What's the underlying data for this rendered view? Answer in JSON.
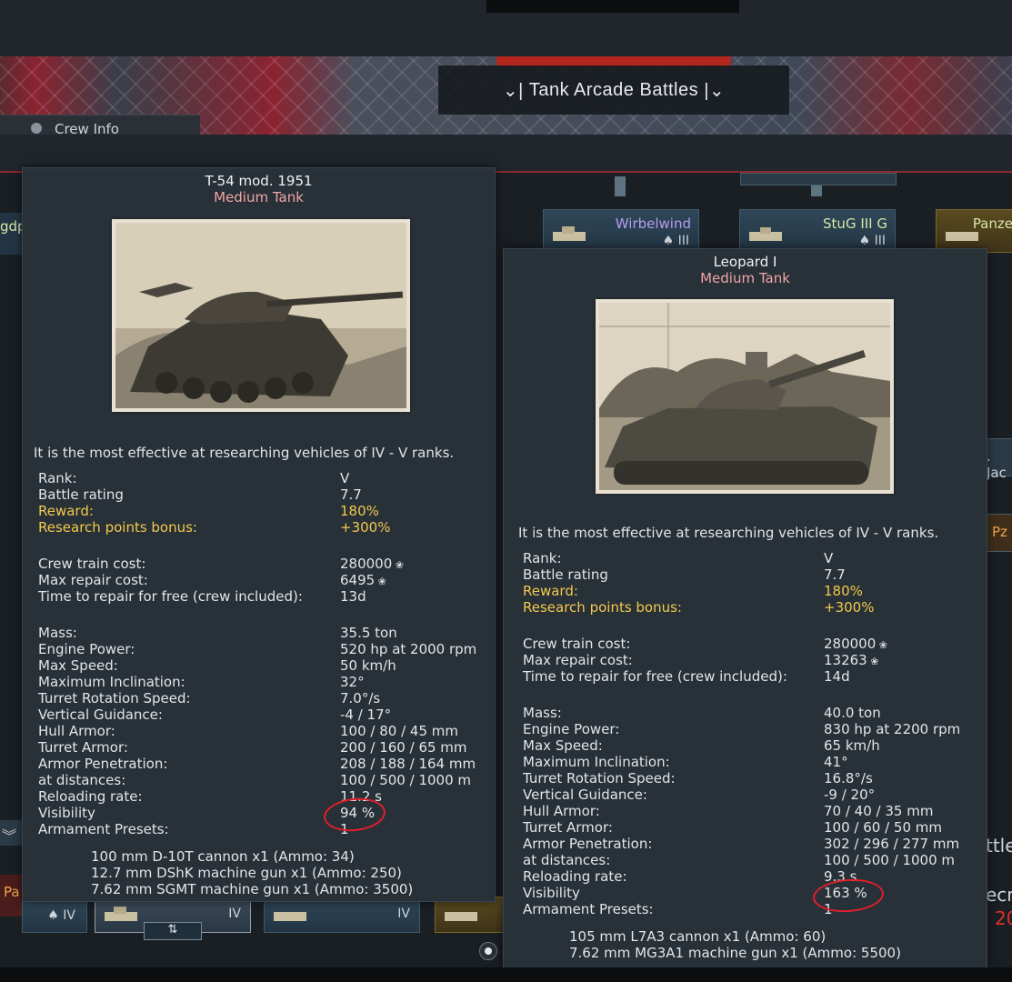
{
  "game_mode": "Tank Arcade Battles",
  "crew_tab": "Crew Info",
  "tree": {
    "top_cards": [
      {
        "name": "Wirbelwind",
        "rank": "III",
        "color": "#b69cf0"
      },
      {
        "name": "StuG III G",
        "rank": "III",
        "color": "#d6e6a8"
      },
      {
        "name": "Panze",
        "rank": "",
        "color": "#d6e6a8"
      }
    ],
    "left_label": "gdp",
    "right_labels": [
      ". Jac",
      "Pz",
      "ttles",
      "ecr",
      "20"
    ],
    "bottom_left_label": "Pa",
    "bottom_cards": [
      {
        "rank": "IV"
      },
      {
        "rank": "IV"
      },
      {
        "rank": "IV"
      }
    ],
    "swap_glyph": "⇅"
  },
  "left_popup": {
    "title": "T-54 mod. 1951",
    "subtitle": "Medium Tank",
    "effective": "It is the most effective at researching vehicles of IV - V ranks.",
    "stats": [
      {
        "label": "Rank:",
        "value": "V"
      },
      {
        "label": "Battle rating",
        "value": "7.7"
      },
      {
        "label": "Reward:",
        "value": "180%",
        "gold": true
      },
      {
        "label": "Research points bonus:",
        "value": "+300%",
        "gold": true
      },
      {
        "label": "Crew train cost:",
        "value": "280000",
        "icon": true
      },
      {
        "label": "Max repair cost:",
        "value": "6495",
        "icon": true
      },
      {
        "label": "Time to repair for free (crew included):",
        "value": "13d"
      },
      {
        "label": "Mass:",
        "value": "35.5 ton"
      },
      {
        "label": "Engine Power:",
        "value": "520 hp at 2000 rpm"
      },
      {
        "label": "Max Speed:",
        "value": "50 km/h"
      },
      {
        "label": "Maximum Inclination:",
        "value": "32°"
      },
      {
        "label": "Turret Rotation Speed:",
        "value": "7.0°/s"
      },
      {
        "label": "Vertical Guidance:",
        "value": "-4 / 17°"
      },
      {
        "label": "Hull Armor:",
        "value": "100 / 80 / 45 mm"
      },
      {
        "label": "Turret Armor:",
        "value": "200 / 160 / 65 mm"
      },
      {
        "label": "Armor Penetration:",
        "value": "208 / 188 / 164 mm"
      },
      {
        "label": "at distances:",
        "value": "100 / 500 / 1000 m"
      },
      {
        "label": "Reloading rate:",
        "value": "11.2 s"
      },
      {
        "label": "Visibility",
        "value": "94 %"
      },
      {
        "label": "Armament Presets:",
        "value": "1"
      }
    ],
    "armament": [
      "100 mm D-10T cannon x1 (Ammo: 34)",
      "12.7 mm DShK machine gun x1 (Ammo: 250)",
      "7.62 mm SGMT machine gun x1 (Ammo: 3500)"
    ]
  },
  "right_popup": {
    "title": "Leopard I",
    "subtitle": "Medium Tank",
    "effective": "It is the most effective at researching vehicles of IV - V ranks.",
    "stats": [
      {
        "label": "Rank:",
        "value": "V"
      },
      {
        "label": "Battle rating",
        "value": "7.7"
      },
      {
        "label": "Reward:",
        "value": "180%",
        "gold": true
      },
      {
        "label": "Research points bonus:",
        "value": "+300%",
        "gold": true
      },
      {
        "label": "Crew train cost:",
        "value": "280000",
        "icon": true
      },
      {
        "label": "Max repair cost:",
        "value": "13263",
        "icon": true
      },
      {
        "label": "Time to repair for free (crew included):",
        "value": "14d"
      },
      {
        "label": "Mass:",
        "value": "40.0 ton"
      },
      {
        "label": "Engine Power:",
        "value": "830 hp at 2200 rpm"
      },
      {
        "label": "Max Speed:",
        "value": "65 km/h"
      },
      {
        "label": "Maximum Inclination:",
        "value": "41°"
      },
      {
        "label": "Turret Rotation Speed:",
        "value": "16.8°/s"
      },
      {
        "label": "Vertical Guidance:",
        "value": "-9 / 20°"
      },
      {
        "label": "Hull Armor:",
        "value": "70 / 40 / 35 mm"
      },
      {
        "label": "Turret Armor:",
        "value": "100 / 60 / 50 mm"
      },
      {
        "label": "Armor Penetration:",
        "value": "302 / 296 / 277 mm"
      },
      {
        "label": "at distances:",
        "value": "100 / 500 / 1000 m"
      },
      {
        "label": "Reloading rate:",
        "value": "9.3 s"
      },
      {
        "label": "Visibility",
        "value": "163 %"
      },
      {
        "label": "Armament Presets:",
        "value": "1"
      }
    ],
    "armament": [
      "105 mm L7A3 cannon x1 (Ammo: 60)",
      "7.62 mm MG3A1 machine gun x1 (Ammo: 5500)"
    ]
  },
  "colors": {
    "gold": "#f2c94c",
    "subtitle": "#f1a5a5",
    "highlight_circle": "#e0202a",
    "mode_red": "#b3271f"
  }
}
